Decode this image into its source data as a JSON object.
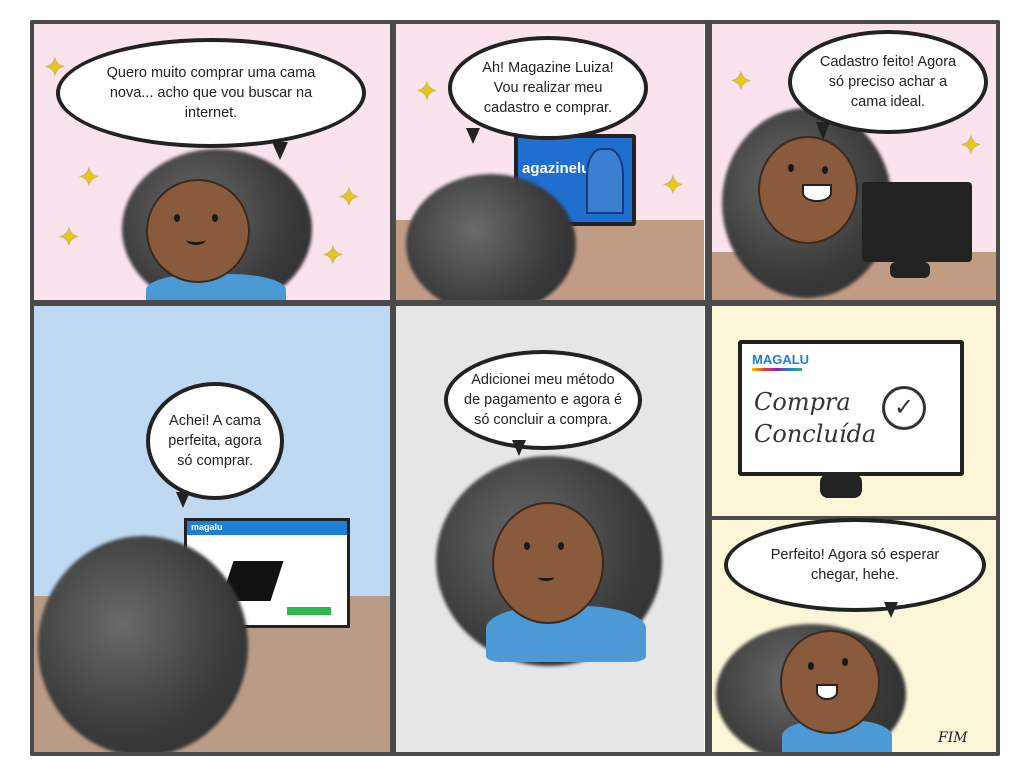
{
  "panels": {
    "p1": {
      "speech": "Quero muito comprar uma cama nova... acho que vou buscar na internet."
    },
    "p2": {
      "speech": "Ah! Magazine Luiza! Vou realizar meu cadastro e comprar.",
      "screen_brand": "agazineluiza"
    },
    "p3": {
      "speech": "Cadastro feito! Agora só preciso achar a cama ideal."
    },
    "p4": {
      "speech": "Achei! A cama perfeita, agora só comprar.",
      "screen_brand": "magalu"
    },
    "p5": {
      "speech": "Adicionei meu método de pagamento e agora é só concluir a compra."
    },
    "p6": {
      "brand": "MAGALU",
      "screen_line1": "Compra",
      "screen_line2": "Concluída",
      "check": "✓",
      "speech": "Perfeito! Agora só esperar chegar, hehe.",
      "ending": "FIM"
    }
  },
  "colors": {
    "pink_bg": "#fbe3ee",
    "blue_bg": "#bfd9f2",
    "gray_bg": "#e6e6e6",
    "yellow_bg": "#fbf6d8",
    "brand_blue": "#1e7fd8",
    "skin": "#8a5a3c",
    "shirt": "#4b9ad6",
    "desk": "#b99479"
  },
  "icons": [
    "sparkle-icon",
    "checkmark-icon",
    "computer-monitor-icon"
  ]
}
